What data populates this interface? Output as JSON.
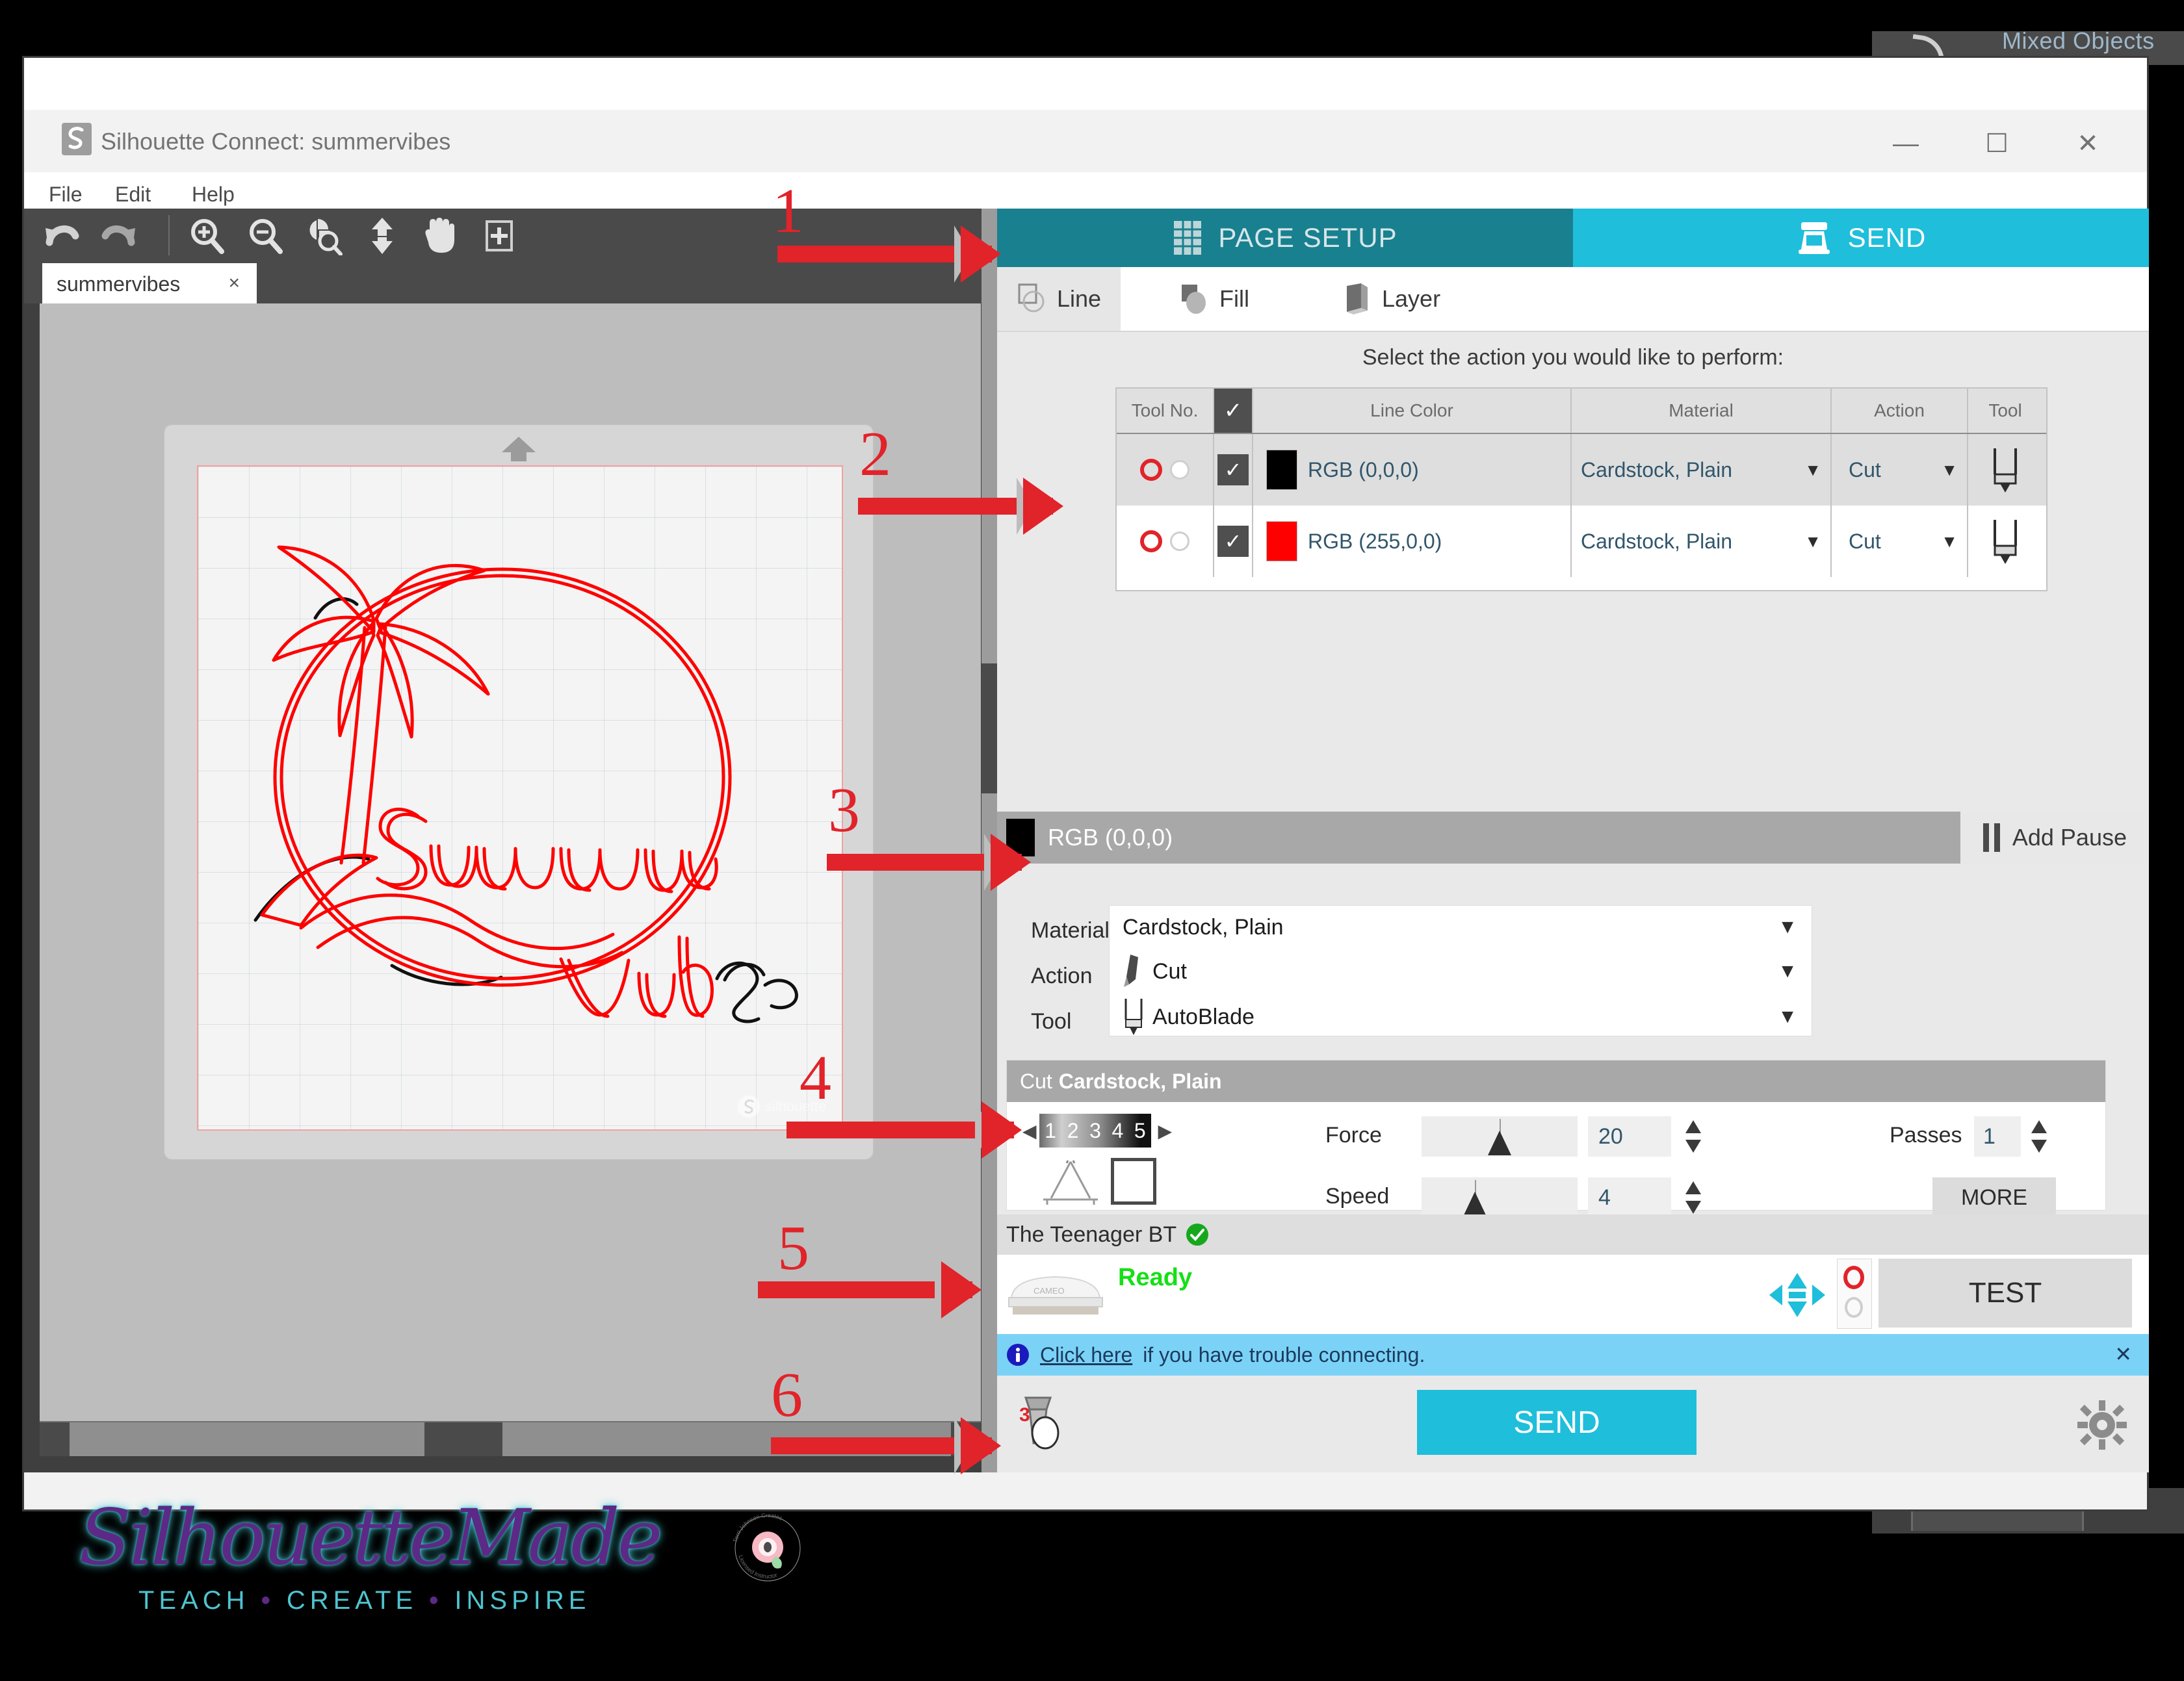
{
  "background": {
    "app_label": "Mixed Objects"
  },
  "window": {
    "title": "Silhouette Connect: summervibes",
    "logo_icon": "silhouette-s-logo",
    "minimize": "—",
    "maximize": "☐",
    "close": "✕"
  },
  "menu": {
    "items": [
      "File",
      "Edit",
      "Help"
    ]
  },
  "toolbar": {
    "items": [
      {
        "name": "undo-button",
        "icon": "undo-arrow-icon"
      },
      {
        "name": "redo-button",
        "icon": "redo-arrow-icon"
      },
      {
        "name": "zoom-in-button",
        "icon": "zoom-in-icon"
      },
      {
        "name": "zoom-out-button",
        "icon": "zoom-out-icon"
      },
      {
        "name": "zoom-selection-button",
        "icon": "zoom-selection-icon"
      },
      {
        "name": "fit-to-page-button",
        "icon": "fit-page-arrows-icon"
      },
      {
        "name": "pan-button",
        "icon": "hand-icon"
      },
      {
        "name": "zoom-region-button",
        "icon": "zoom-region-icon"
      }
    ]
  },
  "document_tab": {
    "label": "summervibes",
    "close": "×"
  },
  "canvas": {
    "mat_arrow_icon": "mat-load-arrow-icon",
    "watermark": "silhouette",
    "design_name": "Summer Vibes palm tree logo",
    "line_colors": [
      "#ff0000",
      "#000000"
    ]
  },
  "branding": {
    "script": "SilhouetteMade",
    "tagline_parts": [
      "TEACH",
      "CREATE",
      "INSPIRE"
    ],
    "tagline_sep": "•",
    "badge_top": "Terri Johnson Creates",
    "badge_bottom": "Licensed Instructor"
  },
  "main_tabs": [
    {
      "label": "PAGE SETUP",
      "icon": "page-grid-icon",
      "active": false
    },
    {
      "label": "SEND",
      "icon": "cutter-machine-icon",
      "active": true
    }
  ],
  "sub_tabs": [
    {
      "label": "Line",
      "icon": "line-shapes-icon",
      "active": true
    },
    {
      "label": "Fill",
      "icon": "fill-shapes-icon",
      "active": false
    },
    {
      "label": "Layer",
      "icon": "layer-stack-icon",
      "active": false
    }
  ],
  "prompt": "Select the action you would like to perform:",
  "action_table": {
    "headers": [
      "Tool No.",
      "✓",
      "Line Color",
      "Material",
      "Action",
      "Tool"
    ],
    "rows": [
      {
        "tool_no": "1",
        "checked": "✓",
        "color_hex": "#000000",
        "color_label": "RGB (0,0,0)",
        "material": "Cardstock, Plain",
        "action": "Cut",
        "tool_icon": "autoblade-icon",
        "caret": "▼"
      },
      {
        "tool_no": "1",
        "checked": "✓",
        "color_hex": "#ff0000",
        "color_label": "RGB (255,0,0)",
        "material": "Cardstock, Plain",
        "action": "Cut",
        "tool_icon": "autoblade-icon",
        "caret": "▼"
      }
    ]
  },
  "color_section": {
    "swatch_hex": "#000000",
    "name": "RGB (0,0,0)",
    "add_pause_label": "Add Pause",
    "pause_icon": "pause-bars-icon"
  },
  "settings": {
    "material_label": "Material",
    "material_value": "Cardstock, Plain",
    "action_label": "Action",
    "action_value": "Cut",
    "action_icon": "blade-tip-icon",
    "tool_label": "Tool",
    "tool_value": "AutoBlade",
    "tool_icon": "autoblade-icon",
    "caret": "▼"
  },
  "cut_settings": {
    "header_prefix": "Cut ",
    "header_material": "Cardstock, Plain",
    "blade_depth_scale": [
      "1",
      "2",
      "3",
      "4",
      "5"
    ],
    "blade_left_arrow": "◀",
    "blade_right_arrow": "▶",
    "compass_icon": "blade-depth-compass-icon",
    "square_icon": "blade-cap-square-icon",
    "force_label": "Force",
    "force_value": "20",
    "speed_label": "Speed",
    "speed_value": "4",
    "passes_label": "Passes",
    "passes_value": "1",
    "more_label": "MORE"
  },
  "machine": {
    "name": "The Teenager BT",
    "connected_icon": "green-check-icon",
    "status": "Ready",
    "device_icon": "cameo-machine-icon",
    "device_label": "CAMEO",
    "arrowpad_icon": "move-arrows-icon",
    "tool_selector_icon": "tool-carriage-selector-icon",
    "test_label": "TEST"
  },
  "banner": {
    "info_icon": "info-circle-icon",
    "link_text": "Click here",
    "text": " if you have trouble connecting.",
    "close": "✕"
  },
  "send_bar": {
    "queue_icon": "cut-queue-icon",
    "queue_badge": "3",
    "send_label": "SEND",
    "gear_icon": "gear-icon"
  },
  "annotations": [
    {
      "number": "1",
      "target": "line-sub-tab"
    },
    {
      "number": "2",
      "target": "action-table-second-row"
    },
    {
      "number": "3",
      "target": "material-action-tool-dropdowns"
    },
    {
      "number": "4",
      "target": "cut-settings-force-speed"
    },
    {
      "number": "5",
      "target": "machine-status-panel"
    },
    {
      "number": "6",
      "target": "send-bar-queue"
    }
  ],
  "colors": {
    "teal_dark": "#19808f",
    "teal_bright": "#1fbedb",
    "annotation_red": "#e1232a",
    "banner_blue": "#7bd2f7",
    "status_green": "#15e015"
  }
}
